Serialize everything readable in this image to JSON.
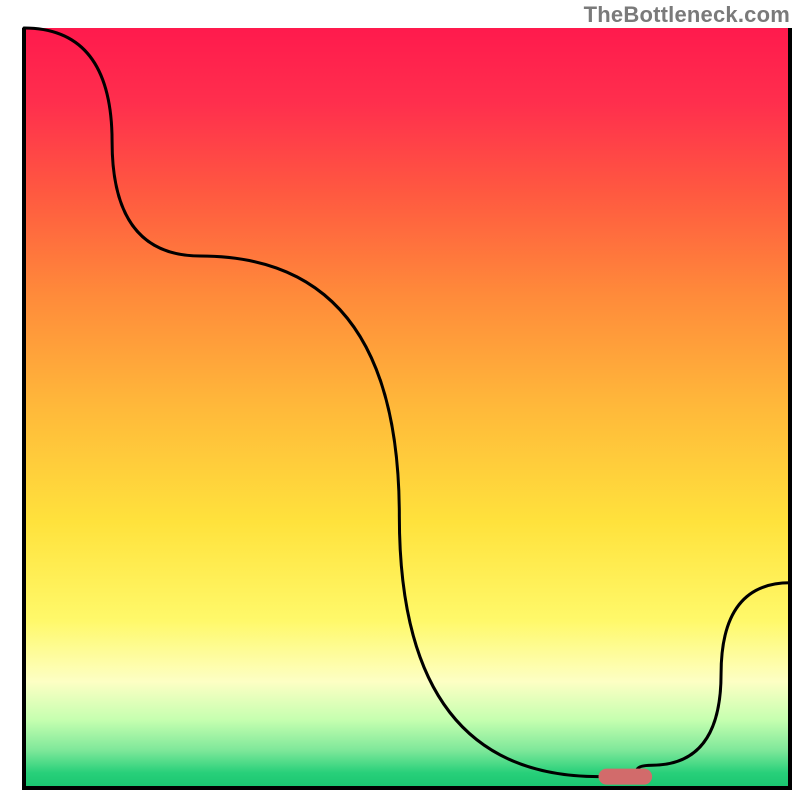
{
  "watermark": "TheBottleneck.com",
  "chart_data": {
    "type": "line",
    "title": "",
    "xlabel": "",
    "ylabel": "",
    "xlim": [
      0,
      100
    ],
    "ylim": [
      0,
      100
    ],
    "grid": false,
    "series": [
      {
        "name": "curve",
        "x": [
          0,
          23,
          75,
          78,
          82,
          100
        ],
        "values": [
          100,
          70,
          1.5,
          1.5,
          3,
          27
        ]
      }
    ],
    "marker": {
      "x_start": 75,
      "x_end": 82,
      "y": 1.5,
      "color": "#d26b6b"
    },
    "band_colors_top_to_bottom": [
      "#ff1a4d",
      "#ff3a4d",
      "#ff6a3c",
      "#ff943a",
      "#ffbf3a",
      "#ffe43c",
      "#fff96a",
      "#fdffc4",
      "#c6ffb0",
      "#7fe89a",
      "#28d07a",
      "#18c56f"
    ]
  }
}
